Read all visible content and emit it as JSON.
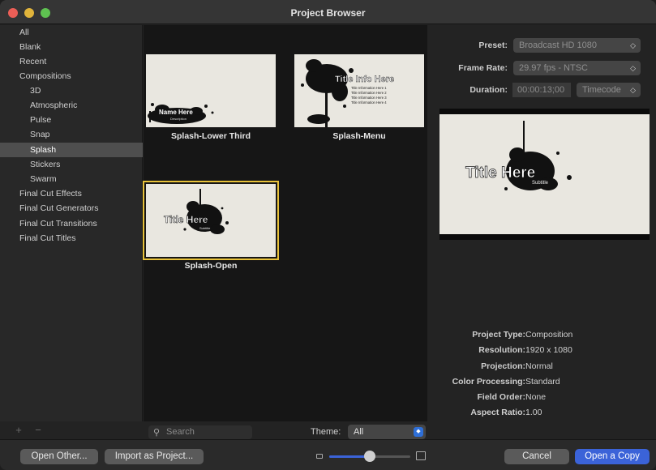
{
  "window": {
    "title": "Project Browser"
  },
  "sidebar": {
    "items": [
      {
        "label": "All"
      },
      {
        "label": "Blank"
      },
      {
        "label": "Recent"
      },
      {
        "label": "Compositions"
      },
      {
        "label": "3D"
      },
      {
        "label": "Atmospheric"
      },
      {
        "label": "Pulse"
      },
      {
        "label": "Snap"
      },
      {
        "label": "Splash"
      },
      {
        "label": "Stickers"
      },
      {
        "label": "Swarm"
      },
      {
        "label": "Final Cut Effects"
      },
      {
        "label": "Final Cut Generators"
      },
      {
        "label": "Final Cut Transitions"
      },
      {
        "label": "Final Cut Titles"
      }
    ],
    "selected": "Splash",
    "add_label": "+",
    "remove_label": "−"
  },
  "templates": [
    {
      "label": "Splash-Lower Third",
      "art_name": "Name Here",
      "art_sub": "Description"
    },
    {
      "label": "Splash-Menu",
      "art_title": "Title Info Here",
      "art_lines": [
        "Title Information Here 1",
        "Title Information Here 2",
        "Title Information Here 3",
        "Title Information Here 4"
      ]
    },
    {
      "label": "Splash-Open",
      "art_title": "Title Here",
      "art_sub": "Subtitle",
      "selected": true
    }
  ],
  "settings": {
    "preset_label": "Preset:",
    "preset_value": "Broadcast HD 1080",
    "frame_rate_label": "Frame Rate:",
    "frame_rate_value": "29.97 fps - NTSC",
    "duration_label": "Duration:",
    "duration_value": "00:00:13;00",
    "duration_format": "Timecode"
  },
  "preview": {
    "title": "Title Here",
    "subtitle": "Subtitle"
  },
  "info": [
    {
      "label": "Project Type:",
      "value": "Composition"
    },
    {
      "label": "Resolution:",
      "value": "1920 x 1080"
    },
    {
      "label": "Projection:",
      "value": "Normal"
    },
    {
      "label": "Color Processing:",
      "value": "Standard"
    },
    {
      "label": "Field Order:",
      "value": "None"
    },
    {
      "label": "Aspect Ratio:",
      "value": "1.00"
    }
  ],
  "search": {
    "placeholder": "Search"
  },
  "theme": {
    "label": "Theme:",
    "value": "All"
  },
  "zoom": {
    "level": 0.5
  },
  "footer": {
    "open_other": "Open Other...",
    "import_as_project": "Import as Project...",
    "cancel": "Cancel",
    "open_copy": "Open a Copy"
  },
  "colors": {
    "accent": "#3b63d8",
    "selection_outline": "#e8c23a"
  }
}
